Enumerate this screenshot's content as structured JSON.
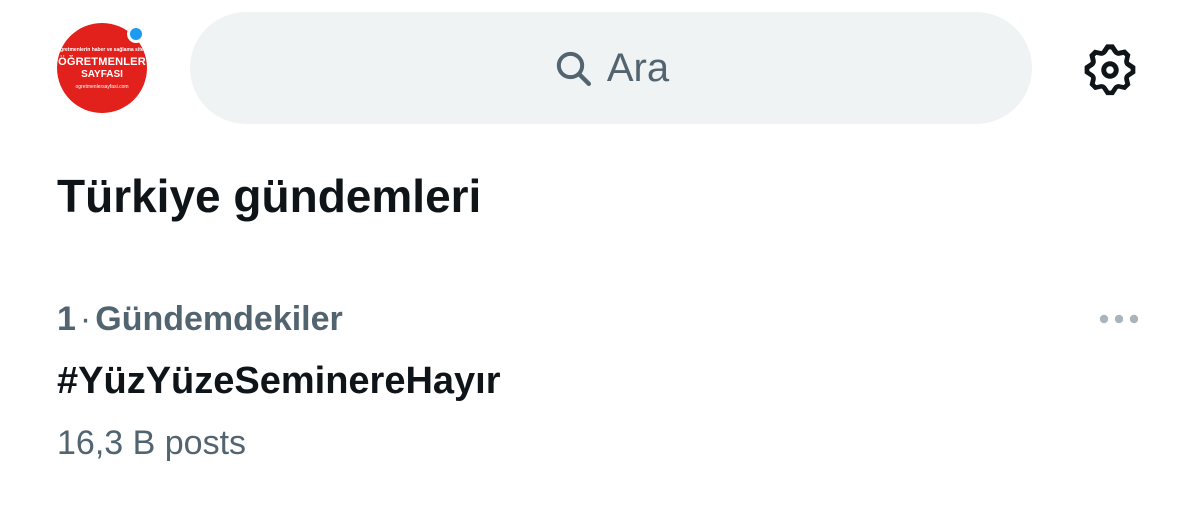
{
  "profile": {
    "avatar_tagline": "Öğretmenlerin haber ve sağlama sitesi",
    "avatar_name_line1": "ÖĞRETMENLER",
    "avatar_name_line2": "SAYFASI",
    "avatar_url": "ogretmenlersayfasi.com",
    "avatar_color": "#e2211c",
    "status_dot_color": "#1d9bf0"
  },
  "search": {
    "icon": "search-icon",
    "placeholder": "Ara"
  },
  "header": {
    "settings_icon": "gear-icon"
  },
  "page": {
    "title": "Türkiye gündemleri"
  },
  "trends": [
    {
      "rank": "1",
      "separator": "·",
      "category": "Gündemdekiler",
      "name": "#YüzYüzeSeminereHayır",
      "count": "16,3 B posts",
      "more_icon": "more-horizontal-icon"
    }
  ],
  "colors": {
    "text_primary": "#0f1419",
    "text_secondary": "#536471",
    "search_bg": "#eff3f4"
  }
}
